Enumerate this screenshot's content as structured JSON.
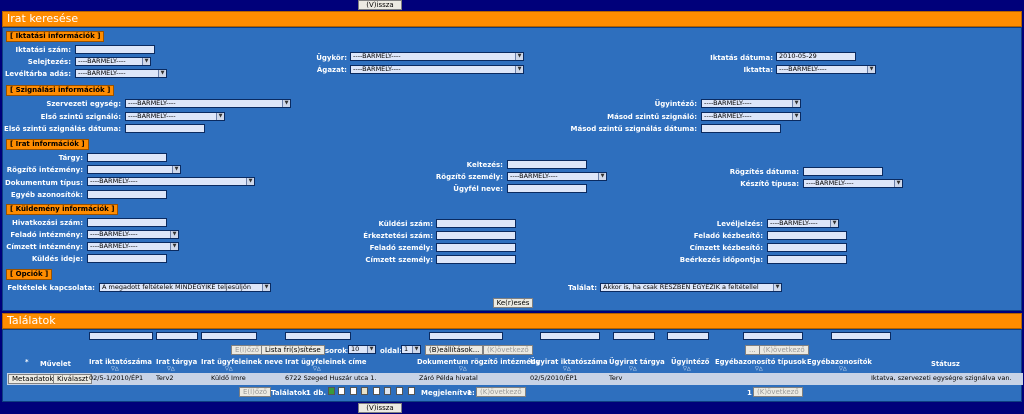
{
  "top_button": "(V)issza",
  "bottom_button": "(V)issza",
  "search": {
    "title": "Irat keresése",
    "sections": {
      "iktatasi": "[ Iktatási információk ]",
      "szignalasi": "[ Szignálási információk ]",
      "irat": "[ Irat információk ]",
      "kuldemeny": "[ Küldemény információk ]",
      "opciok": "[ Opciók ]"
    },
    "labels": {
      "iktatasi_szam": "Iktatási szám:",
      "selejtezes": "Selejtezés:",
      "leveltarba_adas": "Levéltárba adás:",
      "ugykor": "Ügykör:",
      "agazat": "Ágazat:",
      "iktatas_datuma": "Iktatás dátuma:",
      "iktatta": "Iktatta:",
      "szervezeti_egyseg": "Szervezeti egység:",
      "elso_szintu_szignalo": "Első szintű szignáló:",
      "elso_szintu_szignalas_datuma": "Első szintű szignálás dátuma:",
      "ugyintezo": "Ügyintéző:",
      "masod_szintu_szignalo": "Másod szintű szignáló:",
      "masod_szintu_szignalas_datuma": "Másod szintű szignálás dátuma:",
      "targy": "Tárgy:",
      "rogzito_intezmeny": "Rögzítő intézmény:",
      "dokumentum_tipus": "Dokumentum típus:",
      "egyeb_azonositok": "Egyéb azonosítók:",
      "keltezes": "Keltezés:",
      "rogzito_szemely": "Rögzítő személy:",
      "ugyfel_neve": "Ügyfél neve:",
      "rogzites_datuma": "Rögzítés dátuma:",
      "keszito_tipusa": "Készítő típusa:",
      "hivatkozasi_szam": "Hivatkozási szám:",
      "felado_intezmeny": "Feladó intézmény:",
      "cimzett_intezmeny": "Címzett intézmény:",
      "kuldes_ideje": "Küldés ideje:",
      "kuldesi_szam": "Küldési szám:",
      "erkeztetesi_szam": "Érkeztetési szám:",
      "felado_szemely": "Feladó személy:",
      "cimzett_szemely": "Címzett személy:",
      "leveljelzes": "Levéljelzés:",
      "felado_kezbesito": "Feladó kézbesítő:",
      "cimzett_kezbesito": "Címzett kézbesítő:",
      "beerkezes_idopontja": "Beérkezés időpontja:",
      "feltetelek_kapcsolata": "Feltételek kapcsolata:",
      "talalat": "Találat:"
    },
    "values": {
      "barmely": "----BÁRMELY----",
      "iktatas_datuma": "2010-05-29",
      "feltetelek_kapcsolata": "A megadott feltételek MINDEGYIKE teljesüljön",
      "talalat": "Akkor is, ha csak RÉSZBEN EGYEZIK a feltétellel"
    },
    "search_button": "Ke(r)esés"
  },
  "results": {
    "title": "Találatok",
    "toolbar": {
      "prev": "E(l)őző",
      "lista_frissitese": "Lista fri(s)sítése",
      "sorok_label": "sorok:",
      "sorok_value": "10",
      "oldal_label": "oldal:",
      "oldal_value": "1",
      "beallitasok": "(B)eállítások...",
      "next": "(K)övetkező",
      "dots": "...",
      "next2": "(K)övetkező"
    },
    "columns": {
      "star": "*",
      "muvelet": "Művelet",
      "irat_iktatoszama": "Irat iktatószáma",
      "irat_targya": "Irat tárgya",
      "irat_ugyfeleinek_neve": "Irat ügyfeleinek neve",
      "irat_ugyfeleinek_cime": "Irat ügyfeleinek címe",
      "dokumentum_rogzito_intezmeny": "Dokumentum rögzítő intézmény",
      "ugyirat_iktatoszama": "Ügyirat iktatószáma",
      "ugyirat_targya": "Ügyirat tárgya",
      "ugyintezo": "Ügyintéző",
      "egyebazonosito_tipusok": "Egyébazonosító típusok",
      "egyebazonositok": "Egyébazonosítók",
      "statusz": "Státusz"
    },
    "row": {
      "metaadatok": "Metaadatok",
      "kivalaszt": "Kiválaszt",
      "irat_iktatoszama": "02/5-1/2010/ÉP1",
      "irat_targya": "Terv2",
      "ugyfel_neve": "Küldő Imre",
      "ugyfel_cime": "6722 Szeged Huszár utca 1.",
      "rogzito_intezmeny": "Záró Példa hivatal",
      "ugyirat_iktatoszama": "02/5/2010/ÉP1",
      "ugyirat_targya": "Terv",
      "statusz": "Iktatva, szervezeti egységre szignálva van."
    },
    "footer": {
      "prev": "E(l)őző",
      "talalatok_label": "Találatok:",
      "talalatok_value": "1 db.",
      "megjelenitve_label": "Megjelenítve:",
      "megjelenitve_value": "1",
      "next": "(K)övetkező",
      "page_value": "1",
      "next2": "(K)övetkező"
    }
  }
}
